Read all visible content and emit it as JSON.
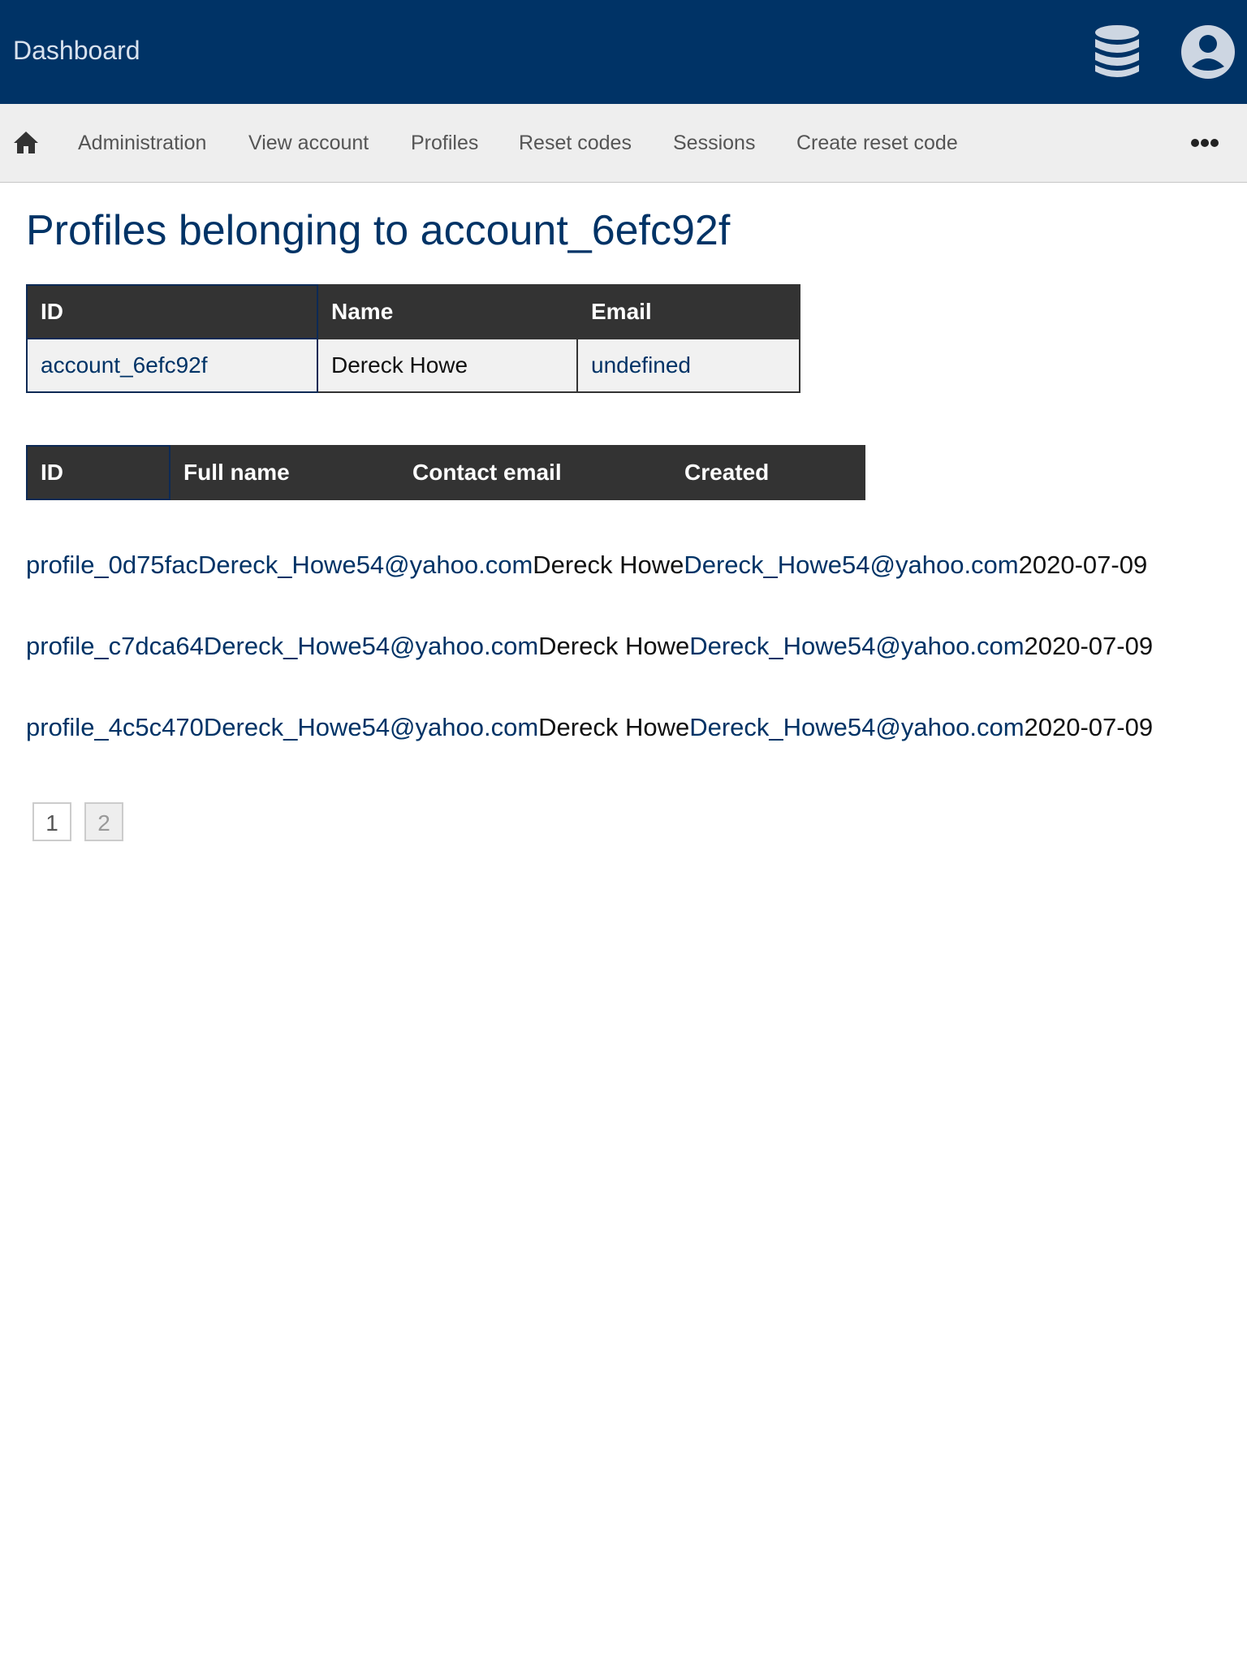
{
  "header": {
    "title": "Dashboard",
    "icons": [
      "database-icon",
      "user-account-icon"
    ]
  },
  "nav": {
    "home_icon": "home-icon",
    "items": [
      {
        "label": "Administration"
      },
      {
        "label": "View account"
      },
      {
        "label": "Profiles"
      },
      {
        "label": "Reset codes"
      },
      {
        "label": "Sessions"
      },
      {
        "label": "Create reset code"
      }
    ],
    "more_icon": "more-horizontal-icon"
  },
  "page": {
    "title": "Profiles belonging to account_6efc92f"
  },
  "account_table": {
    "headers": [
      "ID",
      "Name",
      "Email"
    ],
    "row": [
      "account_6efc92f",
      "Dereck Howe",
      "undefined"
    ]
  },
  "profiles_table": {
    "headers": [
      "ID",
      "Full name",
      "Contact email",
      "Created"
    ],
    "rows": [
      {
        "id": "profile_0d75fac",
        "email1": "Dereck_Howe54@yahoo.com",
        "name": "Dereck Howe",
        "email2": "Dereck_Howe54@yahoo.com",
        "created": "2020-07-09"
      },
      {
        "id": "profile_c7dca64",
        "email1": "Dereck_Howe54@yahoo.com",
        "name": "Dereck Howe",
        "email2": "Dereck_Howe54@yahoo.com",
        "created": "2020-07-09"
      },
      {
        "id": "profile_4c5c470",
        "email1": "Dereck_Howe54@yahoo.com",
        "name": "Dereck Howe",
        "email2": "Dereck_Howe54@yahoo.com",
        "created": "2020-07-09"
      }
    ]
  },
  "pagination": {
    "pages": [
      "1",
      "2"
    ],
    "current": "1"
  },
  "colors": {
    "header_bg": "#003366",
    "nav_bg": "#eeeeee",
    "link": "#003366",
    "table_header_bg": "#333333"
  }
}
